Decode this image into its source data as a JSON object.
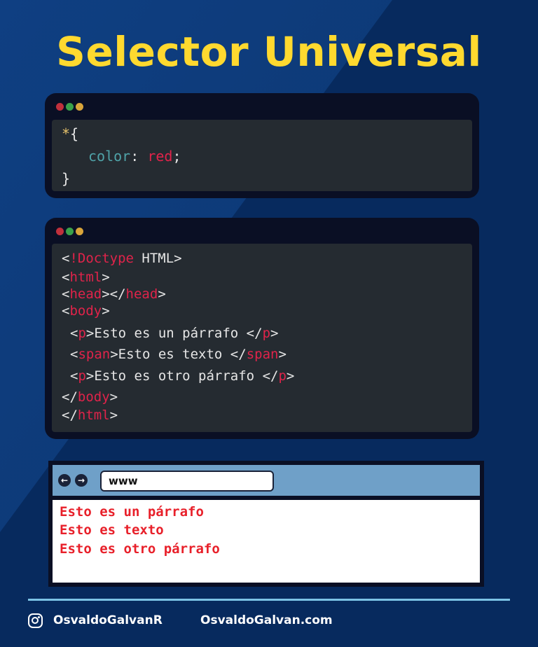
{
  "title": "Selector Universal",
  "colors": {
    "background": "#0d3a78",
    "title": "#ffd92f",
    "dot_red": "#c0303c",
    "dot_green": "#3aa14a",
    "dot_yellow": "#d9a53a",
    "keyword_red": "#e0234a",
    "property_cyan": "#4fa3a8",
    "output_red": "#e8202a",
    "browser_bar": "#6fa0c8",
    "divider": "#7cc3e6"
  },
  "css_snippet": {
    "l1_selector": "*",
    "l1_brace": "{",
    "l2_property": "color",
    "l2_colon": ": ",
    "l2_value": "red",
    "l2_semicolon": ";",
    "l3_brace": "}"
  },
  "html_snippet": {
    "doctype_open": "<",
    "doctype_tag": "!Doctype",
    "doctype_rest": " HTML>",
    "html_open": "<",
    "html_tag": "html",
    "html_close": ">",
    "head_a": "<",
    "head_tag1": "head",
    "head_b": "></",
    "head_tag2": "head",
    "head_c": ">",
    "body_open": "<",
    "body_tag": "body",
    "body_close": ">",
    "p1_a": "<",
    "p1_tag1": "p",
    "p1_text": ">Esto es un párrafo </",
    "p1_tag2": "p",
    "p1_end": ">",
    "span_a": "<",
    "span_tag1": "span",
    "span_text": ">Esto es texto </",
    "span_tag2": "span",
    "span_end": ">",
    "p2_a": "<",
    "p2_tag1": "p",
    "p2_text": ">Esto es otro párrafo </",
    "p2_tag2": "p",
    "p2_end": ">",
    "endbody_a": "</",
    "endbody_tag": "body",
    "endbody_b": ">",
    "endhtml_a": "</",
    "endhtml_tag": "html",
    "endhtml_b": ">"
  },
  "browser": {
    "back_icon": "arrow-left-icon",
    "forward_icon": "arrow-right-icon",
    "back_glyph": "←",
    "forward_glyph": "→",
    "url": "www",
    "output_lines": [
      "Esto es un párrafo",
      "Esto es texto",
      "Esto es otro párrafo"
    ]
  },
  "footer": {
    "instagram_icon": "instagram-icon",
    "handle": "OsvaldoGalvanR",
    "website": "OsvaldoGalvan.com"
  }
}
